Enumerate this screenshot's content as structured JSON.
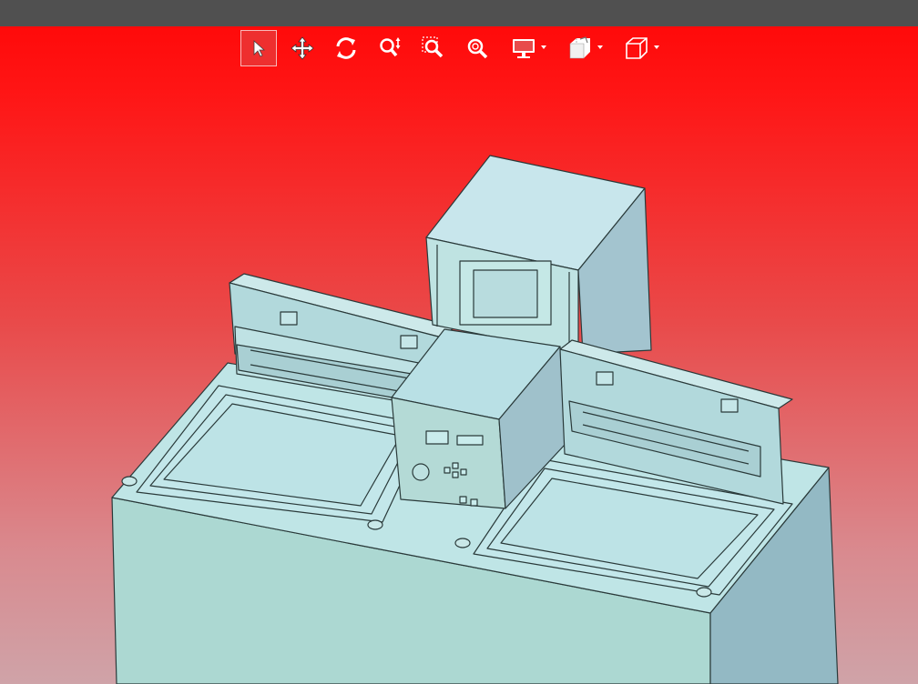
{
  "window": {
    "title_bar_color": "#505050"
  },
  "viewport": {
    "background_top": "#ff0a0a",
    "background_bottom": "#cfa3a8",
    "model_fill": "#b6dde3",
    "model_edge": "#2a3a3a"
  },
  "toolbar": {
    "buttons": [
      {
        "id": "select",
        "icon": "cursor-arrow-icon",
        "active": true,
        "dropdown": false
      },
      {
        "id": "pan",
        "icon": "move-arrows-icon",
        "active": false,
        "dropdown": false
      },
      {
        "id": "rotate",
        "icon": "rotate-icon",
        "active": false,
        "dropdown": false
      },
      {
        "id": "zoom",
        "icon": "zoom-updown-icon",
        "active": false,
        "dropdown": false
      },
      {
        "id": "zoom-window",
        "icon": "zoom-window-icon",
        "active": false,
        "dropdown": false
      },
      {
        "id": "zoom-fit",
        "icon": "zoom-fit-icon",
        "active": false,
        "dropdown": false
      },
      {
        "id": "display",
        "icon": "monitor-icon",
        "active": false,
        "dropdown": true
      },
      {
        "id": "section",
        "icon": "section-cube-icon",
        "active": false,
        "dropdown": true
      },
      {
        "id": "view-orientation",
        "icon": "cube-view-icon",
        "active": false,
        "dropdown": true
      }
    ]
  }
}
